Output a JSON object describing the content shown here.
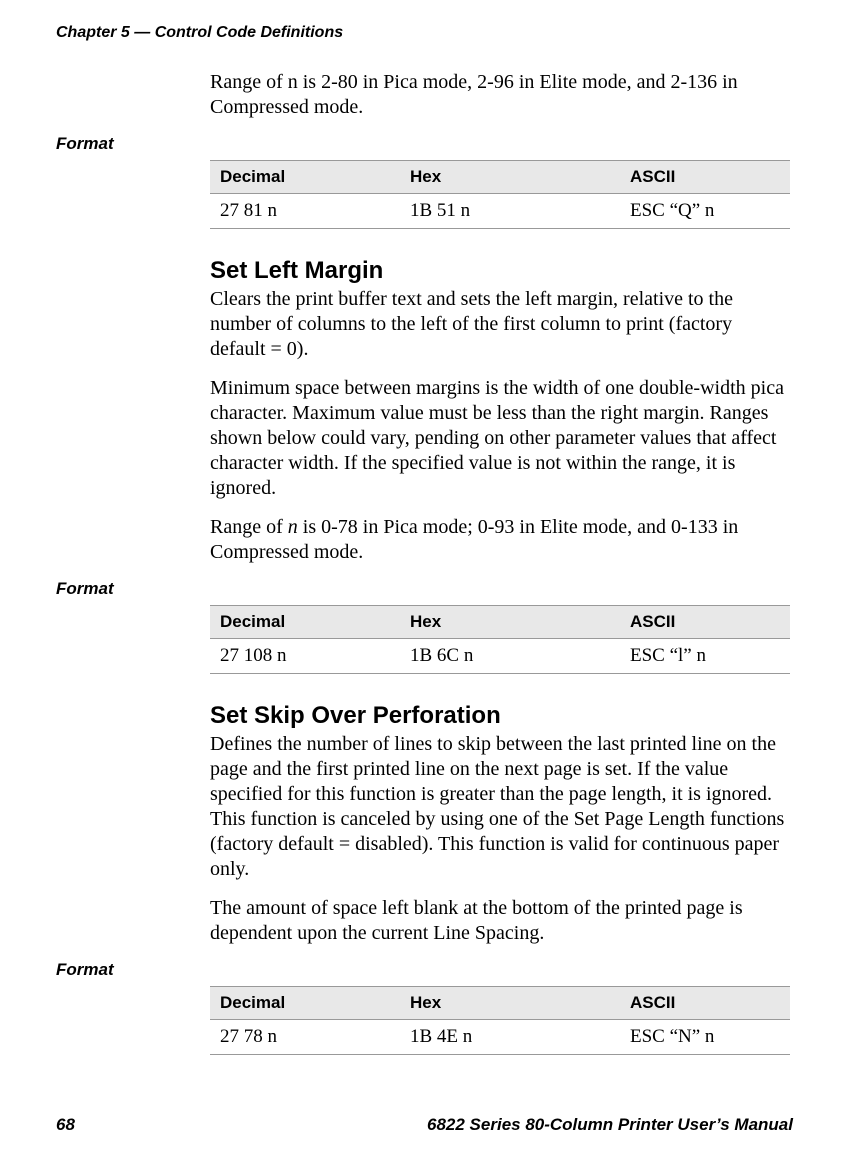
{
  "header": {
    "running": "Chapter 5 — Control Code Definitions"
  },
  "intro": {
    "p1": "Range of n is 2-80 in Pica mode, 2-96 in Elite mode, and 2-136 in Compressed mode."
  },
  "labels": {
    "format": "Format"
  },
  "table_headers": {
    "decimal": "Decimal",
    "hex": "Hex",
    "ascii": "ASCII"
  },
  "table1": {
    "decimal": "27 81 n",
    "hex": "1B 51 n",
    "ascii": "ESC “Q” n"
  },
  "section1": {
    "title": "Set Left Margin",
    "p1": "Clears the print buffer text and sets the left margin, relative to the number of columns to the left of the first column to print (factory default = 0).",
    "p2": "Minimum space between margins is the width of one double-width pica character. Maximum value must be less than the right margin. Ranges shown below could vary, pending on other parameter values that affect character width. If the specified value is not within the range, it is ignored.",
    "p3a": "Range of ",
    "p3n": "n",
    "p3b": " is 0-78 in Pica mode; 0-93 in Elite mode, and 0-133 in Compressed mode."
  },
  "table2": {
    "decimal": "27 108 n",
    "hex": "1B 6C n",
    "ascii": "ESC “l” n"
  },
  "section2": {
    "title": "Set Skip Over Perforation",
    "p1": "Defines the number of lines to skip between the last printed line on the page and the first printed line on the next page is set. If the value specified for this function is greater than the page length, it is ignored. This function is canceled by using one of the Set Page Length functions (factory default = disabled). This function is valid for continuous paper only.",
    "p2": "The amount of space left blank at the bottom of the printed page is dependent upon the current Line Spacing."
  },
  "table3": {
    "decimal": "27 78 n",
    "hex": "1B 4E n",
    "ascii": "ESC “N” n"
  },
  "footer": {
    "page": "68",
    "title": "6822 Series 80-Column Printer User’s Manual"
  }
}
